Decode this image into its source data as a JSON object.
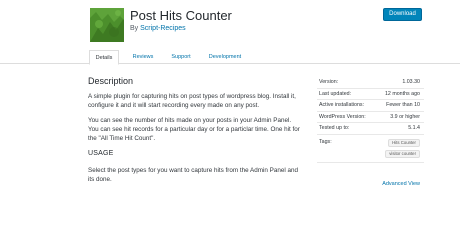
{
  "plugin": {
    "title": "Post Hits Counter",
    "by": "By",
    "author": "Script-Recipes",
    "download_label": "Download",
    "icon_color": "#4c8f2c"
  },
  "tabs": [
    {
      "label": "Details",
      "active": true
    },
    {
      "label": "Reviews",
      "active": false
    },
    {
      "label": "Support",
      "active": false
    },
    {
      "label": "Development",
      "active": false
    }
  ],
  "description": {
    "heading": "Description",
    "paragraphs": [
      "A simple plugin for capturing hits on post types of wordpress blog. Install it, configure it and it will start recording every made on any post.",
      "You can see the number of hits made on your posts in your Admin Panel. You can see hit records for a particular day or for a particlar time. One hit for the \"All Time Hit Count\"."
    ],
    "usage_heading": "USAGE",
    "usage_text": "Select the post types for you want to capture hits from the Admin Panel and its done."
  },
  "meta": [
    {
      "key": "Version:",
      "value": "1.03.30"
    },
    {
      "key": "Last updated:",
      "value": "12 months ago"
    },
    {
      "key": "Active installations:",
      "value": "Fewer than 10"
    },
    {
      "key": "WordPress Version:",
      "value": "3.9 or higher"
    },
    {
      "key": "Tested up to:",
      "value": "5.1.4"
    }
  ],
  "tags": {
    "label": "Tags:",
    "items": [
      "Hits Counter",
      "visitor counter"
    ]
  },
  "advanced_view": "Advanced View",
  "colors": {
    "link": "#0073aa",
    "button": "#0085ba"
  }
}
